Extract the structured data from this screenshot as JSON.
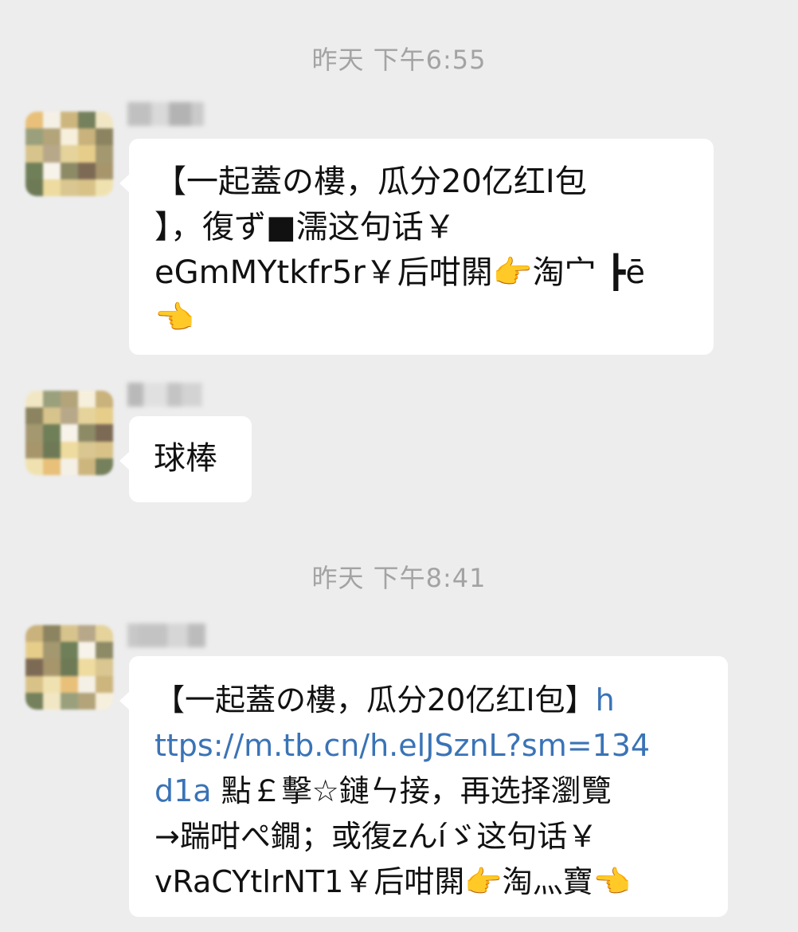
{
  "timestamps": [
    "昨天 下午6:55",
    "昨天 下午8:41"
  ],
  "messages": [
    {
      "lines": [
        "【一起蓋の樓，瓜分20亿红I包",
        "】，復ず■濡这句话￥",
        "eGmMYtkfr5r￥后咁閞👉淘宀 ┣ē",
        "👈"
      ]
    },
    {
      "lines": [
        "球棒"
      ]
    },
    {
      "lines": [
        {
          "text": "【一起蓋の樓，瓜分20亿红I包】",
          "link": "h"
        },
        {
          "link": "ttps://m.tb.cn/h.elJSznL?sm=134"
        },
        {
          "link": "d1a",
          "text": " 點￡擊☆鏈ㄣ接，再选择瀏覽"
        },
        {
          "text": "→踹咁ぺ鐗；或復zんíゞ这句话￥"
        },
        {
          "text": "vRaCYtlrNT1￥后咁閞👉淘灬寶👈"
        }
      ]
    }
  ],
  "avatar_colors": [
    "#e8c07a",
    "#7d6a55",
    "#b8a88a",
    "#f2e7c4",
    "#d9c690",
    "#6f7f58",
    "#c9b27b",
    "#f4f0e6",
    "#a7956c",
    "#e5d39b",
    "#9aa07c",
    "#d8c288",
    "#f7f3ea",
    "#8c8460",
    "#cdb57e",
    "#6e7a56",
    "#e6cd8a",
    "#b3a47a",
    "#f0e2b0",
    "#8d8a66",
    "#d7c38c",
    "#75805c",
    "#eedb9f",
    "#a49870",
    "#f6efdc"
  ],
  "accent": {
    "link_color": "#3a73b6",
    "bubble_bg": "#ffffff",
    "chat_bg": "#ededed"
  }
}
